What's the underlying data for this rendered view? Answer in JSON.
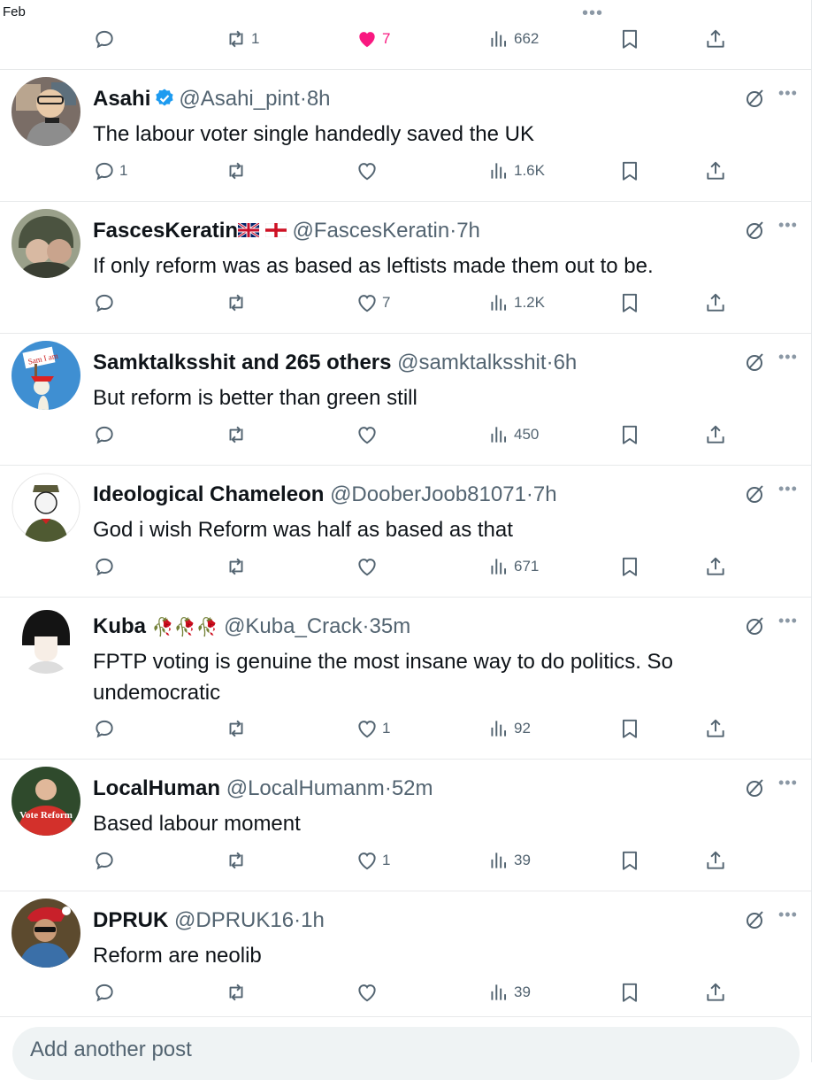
{
  "top": {
    "label": "Feb",
    "more": "•••",
    "reply_count": "",
    "retweet_count": "1",
    "like_count": "7",
    "view_count": "662"
  },
  "tweets": [
    {
      "name": "Asahi",
      "handle": "@Asahi_pint",
      "dot": "·",
      "time": "8h",
      "text": "The labour voter single handedly saved the UK",
      "verified": true,
      "reply_count": "1",
      "retweet_count": "",
      "like_count": "",
      "view_count": "1.6K"
    },
    {
      "name": "FascesKeratin",
      "handle": "@FascesKeratin",
      "dot": "·",
      "time": "7h",
      "text": "If only reform was as based as leftists made them out to be.",
      "reply_count": "",
      "retweet_count": "",
      "like_count": "7",
      "view_count": "1.2K"
    },
    {
      "name": "Samktalksshit and 265 others",
      "handle": "@samktalksshit",
      "dot": "·",
      "time": "6h",
      "text": "But reform is better than green still",
      "reply_count": "",
      "retweet_count": "",
      "like_count": "",
      "view_count": "450"
    },
    {
      "name": "Ideological Chameleon",
      "handle": "@DooberJoob81071",
      "dot": "·",
      "time": "7h",
      "text": "God i wish Reform was half as based as that",
      "reply_count": "",
      "retweet_count": "",
      "like_count": "",
      "view_count": "671"
    },
    {
      "name": "Kuba",
      "handle": "@Kuba_Crack",
      "dot": "·",
      "time": "35m",
      "text": "FPTP voting is genuine the most insane way to do politics. So undemocratic",
      "emoji": "🥀🥀🥀",
      "reply_count": "",
      "retweet_count": "",
      "like_count": "1",
      "view_count": "92"
    },
    {
      "name": "LocalHuman",
      "handle": "@LocalHumanm",
      "dot": "·",
      "time": "52m",
      "text": "Based labour moment",
      "avatar_text": "Vote Reform",
      "reply_count": "",
      "retweet_count": "",
      "like_count": "1",
      "view_count": "39"
    },
    {
      "name": "DPRUK",
      "handle": "@DPRUK16",
      "dot": "·",
      "time": "1h",
      "text": "Reform are neolib",
      "reply_count": "",
      "retweet_count": "",
      "like_count": "",
      "view_count": "39"
    }
  ],
  "avatar3_text": "Sam I am",
  "composer": {
    "placeholder": "Add another post"
  },
  "colors": {
    "like": "#f91880",
    "verified": "#1d9bf0",
    "muted": "#536471"
  }
}
